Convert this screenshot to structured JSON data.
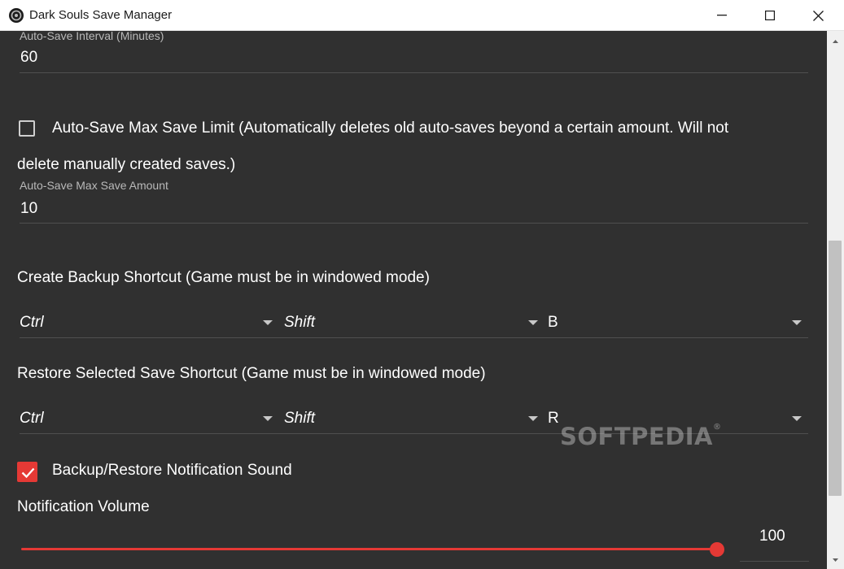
{
  "window": {
    "title": "Dark Souls Save Manager",
    "icon": "app-logo-icon"
  },
  "auto_save_interval": {
    "label": "Auto-Save Interval (Minutes)",
    "value": "60"
  },
  "max_save_limit": {
    "checked": false,
    "label_line1": "Auto-Save Max Save Limit (Automatically deletes old auto-saves beyond a certain amount. Will not",
    "label_line2": "delete manually created saves.)"
  },
  "max_save_amount": {
    "label": "Auto-Save Max Save Amount",
    "value": "10"
  },
  "backup_shortcut": {
    "heading": "Create Backup Shortcut (Game must be in windowed mode)",
    "modifier1": "Ctrl",
    "modifier2": "Shift",
    "key": "B"
  },
  "restore_shortcut": {
    "heading": "Restore Selected Save Shortcut (Game must be in windowed mode)",
    "modifier1": "Ctrl",
    "modifier2": "Shift",
    "key": "R"
  },
  "notification_sound": {
    "checked": true,
    "label": "Backup/Restore Notification Sound"
  },
  "notification_volume": {
    "label": "Notification Volume",
    "value": "100",
    "level_percent": 100
  },
  "watermark": "SOFTPEDIA",
  "colors": {
    "accent": "#e53935",
    "background": "#303030",
    "titlebar": "#ffffff"
  }
}
